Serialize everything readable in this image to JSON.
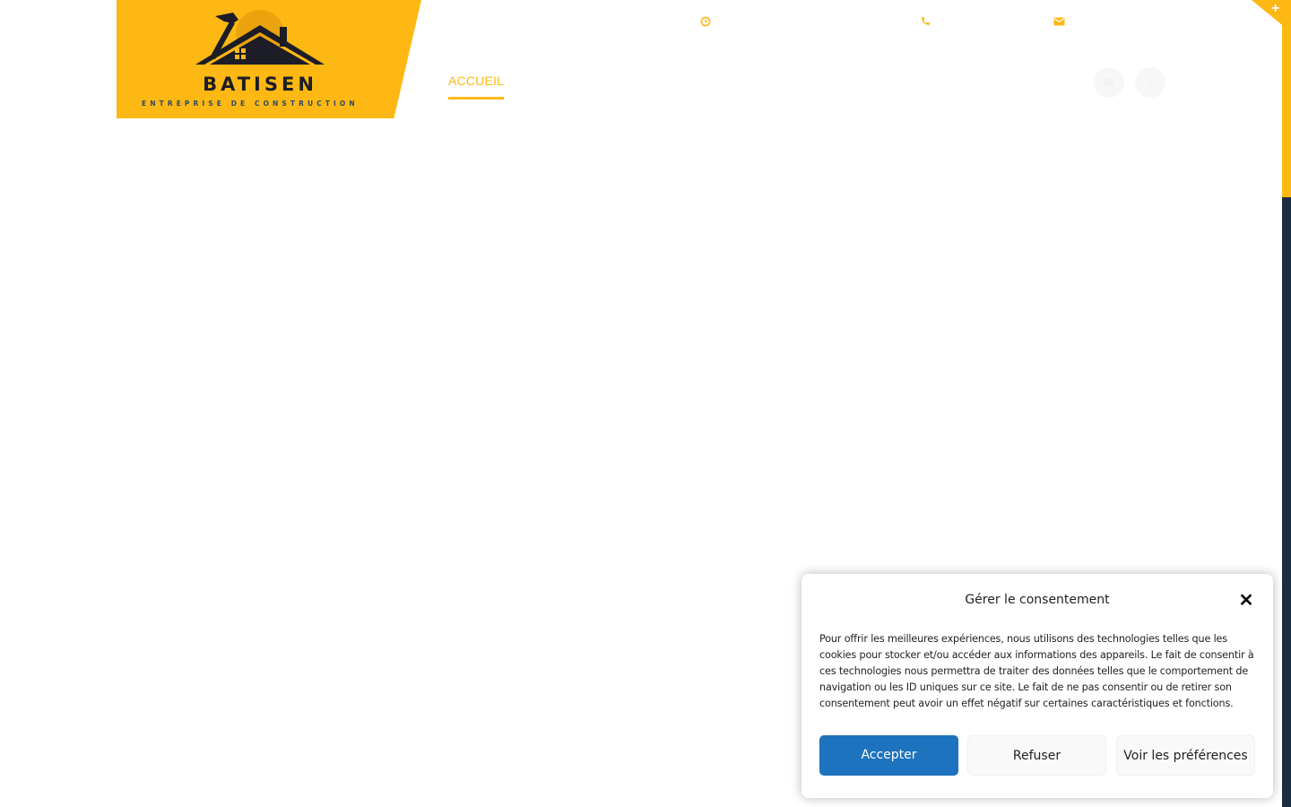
{
  "logo": {
    "name": "BATISEN",
    "tagline": "ENTREPRISE DE CONSTRUCTION"
  },
  "top_info": {
    "icons": [
      "clock-icon",
      "phone-icon",
      "envelope-icon"
    ]
  },
  "nav": {
    "items": [
      {
        "label": "ACCUEIL",
        "active": true
      }
    ]
  },
  "header_buttons": [
    "cart-icon",
    "search-icon"
  ],
  "consent": {
    "title": "Gérer le consentement",
    "body": "Pour offrir les meilleures expériences, nous utilisons des technologies telles que les cookies pour stocker et/ou accéder aux informations des appareils. Le fait de consentir à ces technologies nous permettra de traiter des données telles que le comportement de navigation ou les ID uniques sur ce site. Le fait de ne pas consentir ou de retirer son consentement peut avoir un effet négatif sur certaines caractéristiques et fonctions.",
    "accept_label": "Accepter",
    "refuse_label": "Refuser",
    "prefs_label": "Voir les préférences"
  },
  "colors": {
    "accent": "#fdb813",
    "navy": "#1c2e44",
    "primary_button": "#1e73be"
  }
}
